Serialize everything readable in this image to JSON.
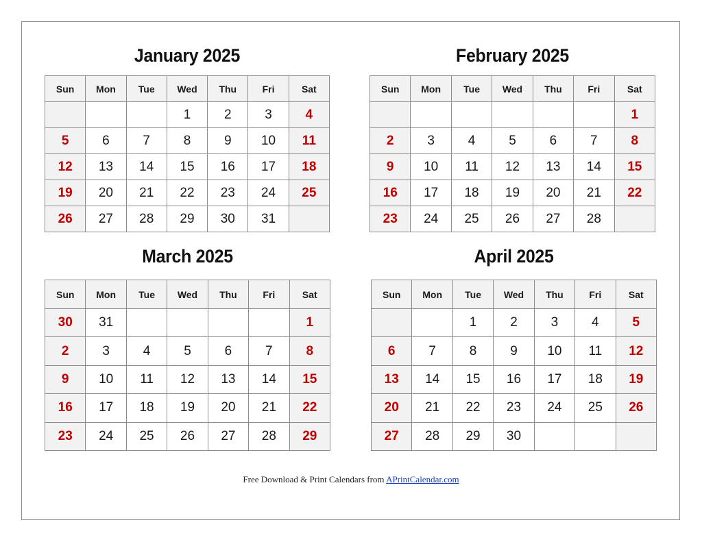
{
  "weekdays": [
    "Sun",
    "Mon",
    "Tue",
    "Wed",
    "Thu",
    "Fri",
    "Sat"
  ],
  "colors": {
    "weekend_text": "#c00000",
    "weekend_bg": "#f2f2f2",
    "border": "#8c8c8c"
  },
  "months": [
    {
      "title": "January 2025",
      "weeks": [
        [
          "",
          "",
          "",
          "1",
          "2",
          "3",
          "4"
        ],
        [
          "5",
          "6",
          "7",
          "8",
          "9",
          "10",
          "11"
        ],
        [
          "12",
          "13",
          "14",
          "15",
          "16",
          "17",
          "18"
        ],
        [
          "19",
          "20",
          "21",
          "22",
          "23",
          "24",
          "25"
        ],
        [
          "26",
          "27",
          "28",
          "29",
          "30",
          "31",
          ""
        ]
      ]
    },
    {
      "title": "February 2025",
      "weeks": [
        [
          "",
          "",
          "",
          "",
          "",
          "",
          "1"
        ],
        [
          "2",
          "3",
          "4",
          "5",
          "6",
          "7",
          "8"
        ],
        [
          "9",
          "10",
          "11",
          "12",
          "13",
          "14",
          "15"
        ],
        [
          "16",
          "17",
          "18",
          "19",
          "20",
          "21",
          "22"
        ],
        [
          "23",
          "24",
          "25",
          "26",
          "27",
          "28",
          ""
        ]
      ]
    },
    {
      "title": "March 2025",
      "weeks": [
        [
          "30",
          "31",
          "",
          "",
          "",
          "",
          "1"
        ],
        [
          "2",
          "3",
          "4",
          "5",
          "6",
          "7",
          "8"
        ],
        [
          "9",
          "10",
          "11",
          "12",
          "13",
          "14",
          "15"
        ],
        [
          "16",
          "17",
          "18",
          "19",
          "20",
          "21",
          "22"
        ],
        [
          "23",
          "24",
          "25",
          "26",
          "27",
          "28",
          "29"
        ]
      ]
    },
    {
      "title": "April 2025",
      "weeks": [
        [
          "",
          "",
          "1",
          "2",
          "3",
          "4",
          "5"
        ],
        [
          "6",
          "7",
          "8",
          "9",
          "10",
          "11",
          "12"
        ],
        [
          "13",
          "14",
          "15",
          "16",
          "17",
          "18",
          "19"
        ],
        [
          "20",
          "21",
          "22",
          "23",
          "24",
          "25",
          "26"
        ],
        [
          "27",
          "28",
          "29",
          "30",
          "",
          "",
          ""
        ]
      ]
    }
  ],
  "footer": {
    "text": "Free Download & Print Calendars from ",
    "link_text": "APrintCalendar.com"
  }
}
